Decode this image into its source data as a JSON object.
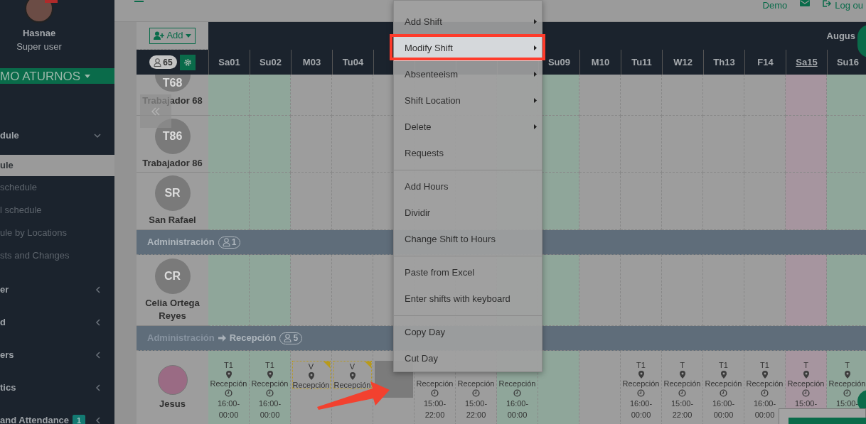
{
  "sidebar": {
    "user": {
      "name": "Hasnae",
      "role": "Super user"
    },
    "company": "MO ATURNOS",
    "items": [
      {
        "label": "dule",
        "expanded": true,
        "children": [
          {
            "label": "ule",
            "selected": true
          },
          {
            "label": "schedule",
            "selected": false
          },
          {
            "label": "l schedule",
            "selected": false
          },
          {
            "label": "ule by Locations",
            "selected": false
          },
          {
            "label": "sts and Changes",
            "selected": false
          }
        ]
      },
      {
        "label": "er",
        "expanded": false
      },
      {
        "label": "d",
        "expanded": false
      },
      {
        "label": "ers",
        "expanded": false
      },
      {
        "label": "tics",
        "expanded": false
      },
      {
        "label": "and Attendance",
        "expanded": false,
        "badge": "1"
      }
    ]
  },
  "topbar": {
    "links": [
      {
        "kind": "text",
        "label": "Demo"
      },
      {
        "kind": "mail"
      },
      {
        "kind": "logout",
        "label": "Log ou"
      }
    ]
  },
  "toolbar": {
    "add_button": "Add",
    "month": "Augus"
  },
  "schedule": {
    "employee_count": "65",
    "days": [
      {
        "label": "Sa01",
        "kind": "weekend"
      },
      {
        "label": "Su02",
        "kind": "weekend"
      },
      {
        "label": "M03",
        "kind": "normal"
      },
      {
        "label": "Tu04",
        "kind": "normal"
      },
      {
        "kind": "normal"
      },
      {
        "kind": "normal"
      },
      {
        "kind": "normal"
      },
      {
        "kind": "weekend"
      },
      {
        "label": "Su09",
        "kind": "weekend"
      },
      {
        "label": "M10",
        "kind": "normal"
      },
      {
        "label": "Tu11",
        "kind": "normal"
      },
      {
        "label": "W12",
        "kind": "normal"
      },
      {
        "label": "Th13",
        "kind": "normal"
      },
      {
        "label": "F14",
        "kind": "normal"
      },
      {
        "label": "Sa15",
        "kind": "holiday"
      },
      {
        "label": "Su16",
        "kind": "weekend"
      }
    ],
    "rows": [
      {
        "kind": "employee",
        "initials": "T68",
        "name": "Trabajador 68"
      },
      {
        "kind": "employee",
        "initials": "T86",
        "name": "Trabajador 86"
      },
      {
        "kind": "employee",
        "initials": "SR",
        "name": "San Rafael"
      },
      {
        "kind": "group",
        "path": [
          "Administración"
        ],
        "count": "1"
      },
      {
        "kind": "employee",
        "initials": "CR",
        "name": "Celia Ortega Reyes"
      },
      {
        "kind": "group",
        "path": [
          "Administración",
          "Recepción"
        ],
        "count": "5"
      },
      {
        "kind": "employee",
        "photo": true,
        "name": "Jesus",
        "shifts": [
          {
            "kind": "shift",
            "code": "T1",
            "location": "Recepción",
            "time": "16:00-00:00",
            "selected": false
          },
          {
            "kind": "shift",
            "code": "T1",
            "location": "Recepción",
            "time": "16:00-00:00",
            "selected": false
          },
          {
            "kind": "absence",
            "code": "V",
            "location": "Recepción",
            "selected": false
          },
          {
            "kind": "absence",
            "code": "V",
            "location": "Recepción",
            "selected": false
          },
          {
            "kind": "absence",
            "selected": true
          },
          {
            "kind": "shift",
            "location": "Recepción",
            "time": "15:00-22:00",
            "selected": false
          },
          {
            "kind": "shift",
            "location": "Recepción",
            "time": "15:00-22:00",
            "selected": false
          },
          {
            "kind": "shift",
            "location": "Recepción",
            "time": "16:00-00:00",
            "selected": false
          },
          {
            "kind": "empty"
          },
          {
            "kind": "empty"
          },
          {
            "kind": "shift",
            "code": "T1",
            "location": "Recepción",
            "time": "16:00-00:00",
            "selected": false
          },
          {
            "kind": "shift",
            "code": "T",
            "location": "Recepción",
            "time": "15:00-22:00",
            "selected": false
          },
          {
            "kind": "shift",
            "code": "T1",
            "location": "Recepción",
            "time": "16:00-00:00",
            "selected": false
          },
          {
            "kind": "shift",
            "code": "T1",
            "location": "Recepción",
            "time": "16:00-00:00",
            "selected": false
          },
          {
            "kind": "shift",
            "code": "T",
            "location": "Recepción",
            "time": "15:00-",
            "selected": false
          },
          {
            "kind": "shift",
            "code": "T",
            "location": "Recepción",
            "time": "15:00-",
            "selected": false
          }
        ]
      }
    ]
  },
  "context_menu": {
    "items": [
      {
        "kind": "item",
        "label": "Add Shift",
        "submenu": true,
        "selected": false
      },
      {
        "kind": "item",
        "label": "Modify Shift",
        "submenu": true,
        "selected": true
      },
      {
        "kind": "item",
        "label": "Absenteeism",
        "submenu": true,
        "selected": false
      },
      {
        "kind": "item",
        "label": "Shift Location",
        "submenu": true,
        "selected": false
      },
      {
        "kind": "item",
        "label": "Delete",
        "submenu": true,
        "selected": false
      },
      {
        "kind": "item",
        "label": "Requests",
        "submenu": false,
        "selected": false
      },
      {
        "kind": "divider"
      },
      {
        "kind": "item",
        "label": "Add Hours",
        "submenu": false,
        "selected": false
      },
      {
        "kind": "item",
        "label": "Dividir",
        "submenu": false,
        "selected": false
      },
      {
        "kind": "item",
        "label": "Change Shift to Hours",
        "submenu": false,
        "selected": false
      },
      {
        "kind": "divider"
      },
      {
        "kind": "item",
        "label": "Paste from Excel",
        "submenu": false,
        "selected": false
      },
      {
        "kind": "item",
        "label": "Enter shifts with keyboard",
        "submenu": false,
        "selected": false
      },
      {
        "kind": "divider"
      },
      {
        "kind": "item",
        "label": "Copy Day",
        "submenu": false,
        "selected": false
      },
      {
        "kind": "item",
        "label": "Cut Day",
        "submenu": false,
        "selected": false
      }
    ]
  }
}
